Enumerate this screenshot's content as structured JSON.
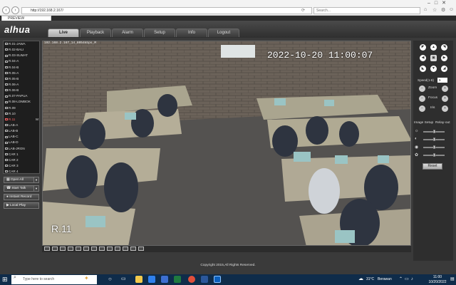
{
  "browser": {
    "url": "http://192.168.2.167/",
    "search_placeholder": "Search...",
    "tab_title": "PREVIEW"
  },
  "app": {
    "logo": "alhua",
    "tabs": [
      {
        "label": "Live",
        "active": true
      },
      {
        "label": "Playback"
      },
      {
        "label": "Alarm"
      },
      {
        "label": "Setup"
      },
      {
        "label": "Info"
      },
      {
        "label": "Logout"
      }
    ]
  },
  "channels": [
    {
      "label": "R.01-JAWA"
    },
    {
      "label": "R.02-BALI"
    },
    {
      "label": "R.03-SUMAT"
    },
    {
      "label": "R.04-A"
    },
    {
      "label": "R.04-B"
    },
    {
      "label": "R.05-A"
    },
    {
      "label": "R.05-B"
    },
    {
      "label": "R.06-A"
    },
    {
      "label": "R.06-B"
    },
    {
      "label": "R.07-PAPUA"
    },
    {
      "label": "R.08-LOMBOK"
    },
    {
      "label": "R.09"
    },
    {
      "label": "R.10"
    },
    {
      "label": "R.11",
      "mark": "M"
    },
    {
      "label": "LAB-A"
    },
    {
      "label": "LAB-B"
    },
    {
      "label": "LAB-C"
    },
    {
      "label": "LAB-D"
    },
    {
      "label": "LAB-JRGN"
    },
    {
      "label": "CAR 1"
    },
    {
      "label": "CAR 2"
    },
    {
      "label": "CAR 3"
    },
    {
      "label": "CAR 4"
    }
  ],
  "side_buttons": {
    "open_all": "Open All",
    "start_talk": "Start Talk",
    "instant_record": "Instant Record",
    "local_play": "Local Play"
  },
  "video": {
    "info": "192.168.2.167_14_8054kbps_M",
    "timestamp": "2022-10-20 11:00:07",
    "channel_name": "R.11"
  },
  "ptz": {
    "speed_label": "Speed(1-8)",
    "speed_value": "5",
    "zoom_label": "Zoom",
    "focus_label": "Focus",
    "iris_label": "Iris"
  },
  "image_setup": {
    "title": "Image Setup",
    "relay_label": "Relay-out",
    "reset_label": "Reset",
    "levels": [
      0.5,
      0.5,
      0.5,
      0.5
    ]
  },
  "footer": {
    "copyright": "Copyright 2015,All Rights Reserved."
  },
  "taskbar": {
    "search_placeholder": "Type here to search",
    "weather_temp": "31°C",
    "weather_text": "Berawan",
    "time": "11:00",
    "date": "10/20/2022"
  }
}
